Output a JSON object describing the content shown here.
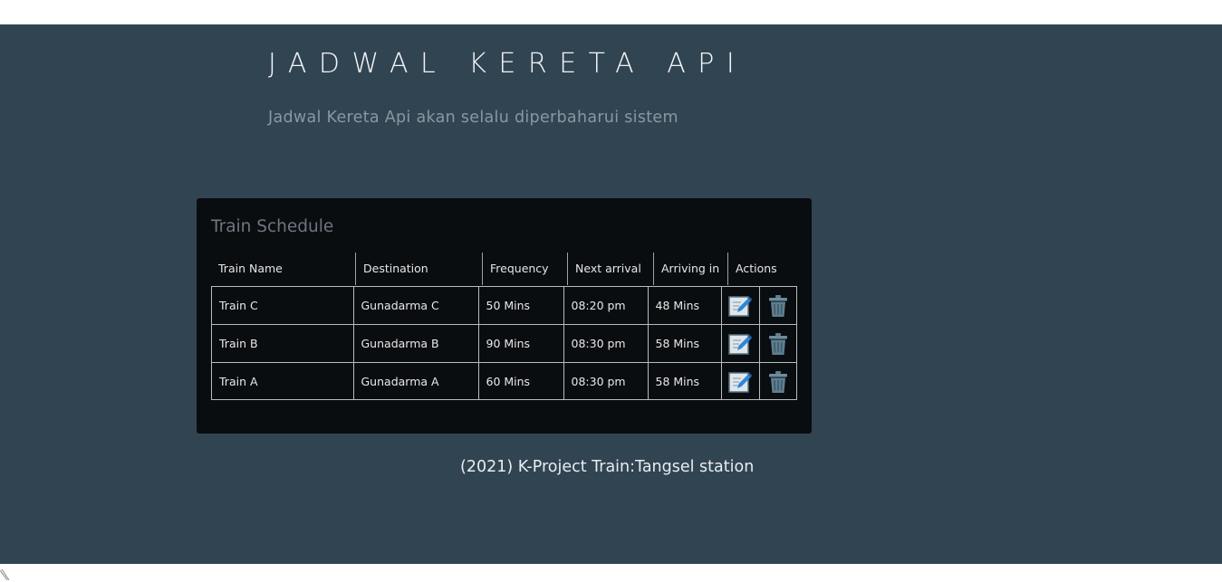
{
  "header": {
    "title": "JADWAL KERETA API",
    "subtitle": "Jadwal Kereta Api akan selalu diperbaharui sistem"
  },
  "schedule": {
    "title": "Train Schedule",
    "columns": [
      "Train Name",
      "Destination",
      "Frequency",
      "Next arrival",
      "Arriving in",
      "Actions"
    ],
    "rows": [
      {
        "name": "Train C",
        "destination": "Gunadarma C",
        "frequency": "50 Mins",
        "next_arrival": "08:20 pm",
        "arriving_in": "48 Mins"
      },
      {
        "name": "Train B",
        "destination": "Gunadarma B",
        "frequency": "90 Mins",
        "next_arrival": "08:30 pm",
        "arriving_in": "58 Mins"
      },
      {
        "name": "Train A",
        "destination": "Gunadarma A",
        "frequency": "60 Mins",
        "next_arrival": "08:30 pm",
        "arriving_in": "58 Mins"
      }
    ],
    "action_icons": [
      "edit-icon",
      "trash-icon"
    ]
  },
  "footer": {
    "text": "(2021) K-Project Train:Tangsel station"
  },
  "colors": {
    "background": "#314452",
    "panel": "#0a0d10",
    "edit_icon_blue": "#2f86d6",
    "trash_icon": "#5e7f91"
  }
}
